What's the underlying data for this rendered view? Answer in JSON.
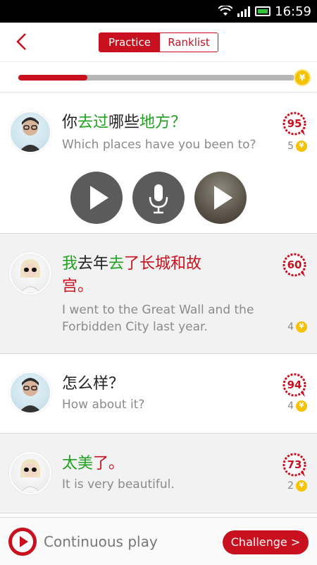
{
  "status_bar": {
    "time": "16:59"
  },
  "header": {
    "tabs": [
      {
        "label": "Practice",
        "active": true
      },
      {
        "label": "Ranklist",
        "active": false
      }
    ]
  },
  "progress": {
    "fraction": 0.25,
    "end_icon": "¥"
  },
  "items": [
    {
      "speaker": "male",
      "zh_segments": [
        {
          "text": "你",
          "color": "#222222"
        },
        {
          "text": "去过",
          "color": "#22a022"
        },
        {
          "text": "哪些",
          "color": "#222222"
        },
        {
          "text": "地方",
          "color": "#22a022"
        },
        {
          "text": "？",
          "color": "#22a022"
        }
      ],
      "en": "Which places have you been to?",
      "score": "95",
      "coins": "5"
    },
    {
      "speaker": "female",
      "zh_segments": [
        {
          "text": "我",
          "color": "#22a022"
        },
        {
          "text": "去年",
          "color": "#222222"
        },
        {
          "text": "去",
          "color": "#22a022"
        },
        {
          "text": "了长城和故宫。",
          "color": "#c8101e"
        }
      ],
      "en": "I went to the Great Wall and the Forbidden City last year.",
      "score": "60",
      "coins": "4"
    },
    {
      "speaker": "male",
      "zh_segments": [
        {
          "text": "怎么样？",
          "color": "#222222"
        }
      ],
      "en": "How about it?",
      "score": "94",
      "coins": "4"
    },
    {
      "speaker": "female",
      "zh_segments": [
        {
          "text": "太美",
          "color": "#22a022"
        },
        {
          "text": "了。",
          "color": "#c8101e"
        }
      ],
      "en": "It is very beautiful.",
      "score": "73",
      "coins": "2"
    }
  ],
  "controls": {
    "icons": [
      "play-icon",
      "microphone-icon",
      "replay-recording-icon"
    ]
  },
  "bottom_bar": {
    "continuous_label": "Continuous play",
    "challenge_label": "Challenge >"
  },
  "colors": {
    "accent": "#c8101e",
    "green": "#22a022",
    "gold": "#f5c200"
  }
}
